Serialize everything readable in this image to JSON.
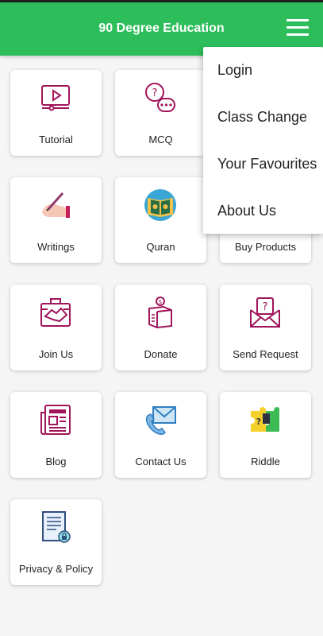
{
  "appbar": {
    "title": "90 Degree Education",
    "menu_icon": "hamburger-menu-icon"
  },
  "menu": {
    "items": [
      "Login",
      "Class Change",
      "Your Favourites",
      "About Us"
    ]
  },
  "grid": {
    "items": [
      {
        "label": "Tutorial",
        "icon": "video-player-icon"
      },
      {
        "label": "MCQ",
        "icon": "question-chat-icon"
      },
      {
        "label": "",
        "icon": ""
      },
      {
        "label": "Writings",
        "icon": "writing-hand-icon"
      },
      {
        "label": "Quran",
        "icon": "quran-book-icon"
      },
      {
        "label": "Buy Products",
        "icon": "cart-icon"
      },
      {
        "label": "Join Us",
        "icon": "handshake-briefcase-icon"
      },
      {
        "label": "Donate",
        "icon": "donation-box-icon"
      },
      {
        "label": "Send Request",
        "icon": "envelope-question-icon"
      },
      {
        "label": "Blog",
        "icon": "newspaper-icon"
      },
      {
        "label": "Contact Us",
        "icon": "envelope-phone-icon"
      },
      {
        "label": "Riddle",
        "icon": "puzzle-icon"
      },
      {
        "label": "Privacy & Policy",
        "icon": "secure-document-icon"
      }
    ]
  },
  "colors": {
    "appbar": "#2dbd5b",
    "icon_primary": "#a0145a",
    "background": "#f5f5f5"
  }
}
